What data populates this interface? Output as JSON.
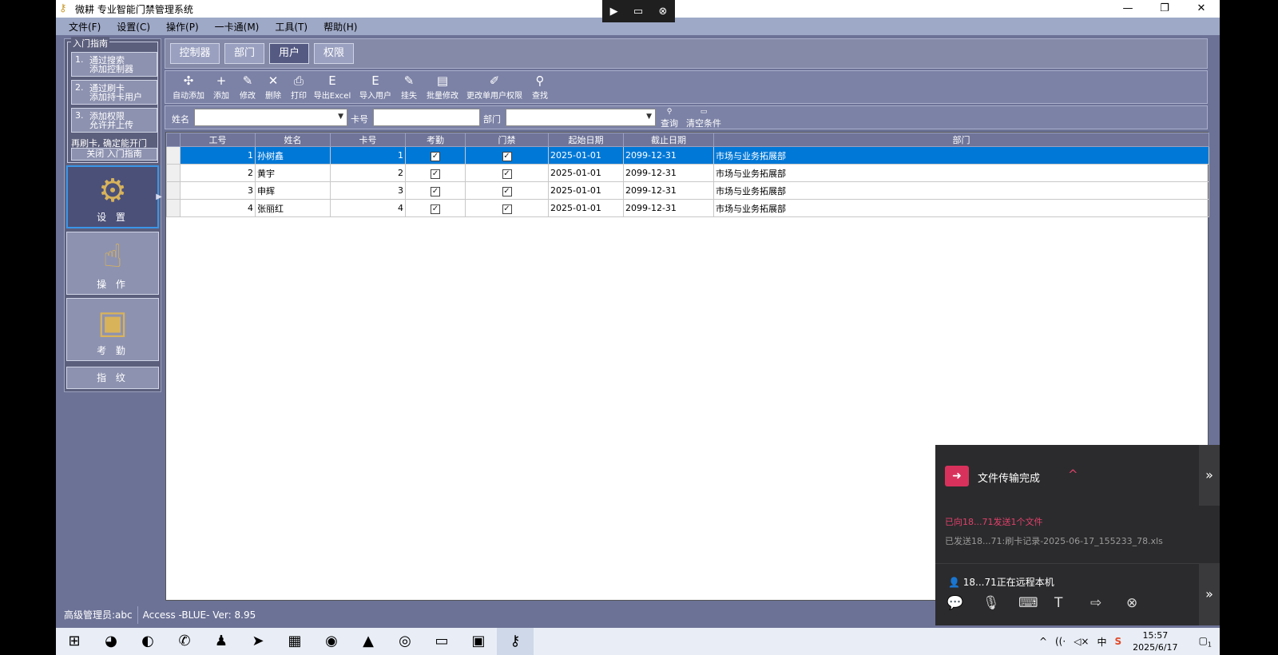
{
  "app": {
    "title": "微耕 专业智能门禁管理系统",
    "controls": [
      "—",
      "❐",
      "✕"
    ]
  },
  "remote_bar": {
    "icons": [
      "▶",
      "▭",
      "⊗"
    ]
  },
  "menu": [
    "文件(F)",
    "设置(C)",
    "操作(P)",
    "一卡通(M)",
    "工具(T)",
    "帮助(H)"
  ],
  "guide": {
    "legend": "入门指南",
    "steps": [
      {
        "num": "1.",
        "line1": "通过搜索",
        "line2": "添加控制器"
      },
      {
        "num": "2.",
        "line1": "通过刷卡",
        "line2": "添加持卡用户"
      },
      {
        "num": "3.",
        "line1": "添加权限",
        "line2": "允许并上传"
      }
    ],
    "tip": "再刷卡, 确定能开门",
    "close_label": "关闭 入门指南"
  },
  "nav": [
    {
      "label": "设 置",
      "icon": "gear-icon"
    },
    {
      "label": "操 作",
      "icon": "hand-icon"
    },
    {
      "label": "考 勤",
      "icon": "attendance-icon"
    },
    {
      "label": "指 纹",
      "icon": "fingerprint-icon"
    }
  ],
  "tabs": [
    "控制器",
    "部门",
    "用户",
    "权限"
  ],
  "active_tab": "用户",
  "toolbar": [
    {
      "label": "自动添加",
      "icon": "auto-add-icon",
      "glyph": "✣"
    },
    {
      "label": "添加",
      "icon": "plus-icon",
      "glyph": "+"
    },
    {
      "label": "修改",
      "icon": "pencil-icon",
      "glyph": "✎"
    },
    {
      "label": "删除",
      "icon": "delete-icon",
      "glyph": "✕"
    },
    {
      "label": "打印",
      "icon": "printer-icon",
      "glyph": "⎙"
    },
    {
      "label": "导出Excel",
      "icon": "export-excel-icon",
      "glyph": "E"
    },
    {
      "label": "导入用户",
      "icon": "import-icon",
      "glyph": "E"
    },
    {
      "label": "挂失",
      "icon": "report-loss-icon",
      "glyph": "✎"
    },
    {
      "label": "批量修改",
      "icon": "batch-edit-icon",
      "glyph": "▤"
    },
    {
      "label": "更改单用户权限",
      "icon": "user-permission-icon",
      "glyph": "✐"
    },
    {
      "label": "查找",
      "icon": "search-icon",
      "glyph": "⚲"
    }
  ],
  "search": {
    "name_label": "姓名",
    "name_value": "",
    "card_label": "卡号",
    "card_value": "",
    "dept_label": "部门",
    "dept_value": "",
    "query_label": "查询",
    "clear_label": "清空条件"
  },
  "grid": {
    "columns": [
      "工号",
      "姓名",
      "卡号",
      "考勤",
      "门禁",
      "起始日期",
      "截止日期",
      "部门"
    ],
    "rows": [
      {
        "id": "1",
        "name": "孙树鑫",
        "card": "1",
        "attend": true,
        "access": true,
        "start": "2025-01-01",
        "end": "2099-12-31",
        "dept": "市场与业务拓展部",
        "selected": true
      },
      {
        "id": "2",
        "name": "黄宇",
        "card": "2",
        "attend": true,
        "access": true,
        "start": "2025-01-01",
        "end": "2099-12-31",
        "dept": "市场与业务拓展部",
        "selected": false
      },
      {
        "id": "3",
        "name": "申辉",
        "card": "3",
        "attend": true,
        "access": true,
        "start": "2025-01-01",
        "end": "2099-12-31",
        "dept": "市场与业务拓展部",
        "selected": false
      },
      {
        "id": "4",
        "name": "张丽红",
        "card": "4",
        "attend": true,
        "access": true,
        "start": "2025-01-01",
        "end": "2099-12-31",
        "dept": "市场与业务拓展部",
        "selected": false
      }
    ]
  },
  "status": {
    "user": "高级管理员:abc",
    "version": "Access -BLUE- Ver: 8.95"
  },
  "transfer": {
    "title": "文件传输完成",
    "sent_count": "已向18...71发送1个文件",
    "sent_file": "已发送18...71:刷卡记录-2025-06-17_155233_78.xls",
    "remote_status": "18...71正在远程本机",
    "side_glyph": "»",
    "caret": "^",
    "remote_icons": [
      {
        "icon": "chat-icon",
        "glyph": "💬"
      },
      {
        "icon": "microphone-icon",
        "glyph": "🎙"
      },
      {
        "icon": "keyboard-icon",
        "glyph": "⌨"
      },
      {
        "icon": "text-icon",
        "glyph": "T"
      },
      {
        "icon": "folder-send-icon",
        "glyph": "⇨"
      },
      {
        "icon": "close-circle-icon",
        "glyph": "⊗"
      }
    ]
  },
  "taskbar": {
    "apps": [
      {
        "icon": "windows-start-icon",
        "glyph": "⊞"
      },
      {
        "icon": "app-colorful-icon",
        "glyph": "◕"
      },
      {
        "icon": "edge-browser-icon",
        "glyph": "◐"
      },
      {
        "icon": "wechat-icon",
        "glyph": "✆"
      },
      {
        "icon": "qq-icon",
        "glyph": "♟"
      },
      {
        "icon": "feishu-icon",
        "glyph": "➤"
      },
      {
        "icon": "winrar-icon",
        "glyph": "▦"
      },
      {
        "icon": "screen-capture-icon",
        "glyph": "◉"
      },
      {
        "icon": "mountain-app-icon",
        "glyph": "▲"
      },
      {
        "icon": "chrome-icon",
        "glyph": "◎"
      },
      {
        "icon": "file-explorer-icon",
        "glyph": "▭"
      },
      {
        "icon": "remote-desktop-icon",
        "glyph": "▣"
      },
      {
        "icon": "access-control-app-icon",
        "glyph": "⚷"
      }
    ],
    "tray": {
      "chevron": "^",
      "network": "((·",
      "sound": "◁×",
      "ime": "中",
      "sogou": "S",
      "time": "15:57",
      "date": "2025/6/17",
      "notification": "▢",
      "notification_badge": "1"
    }
  }
}
